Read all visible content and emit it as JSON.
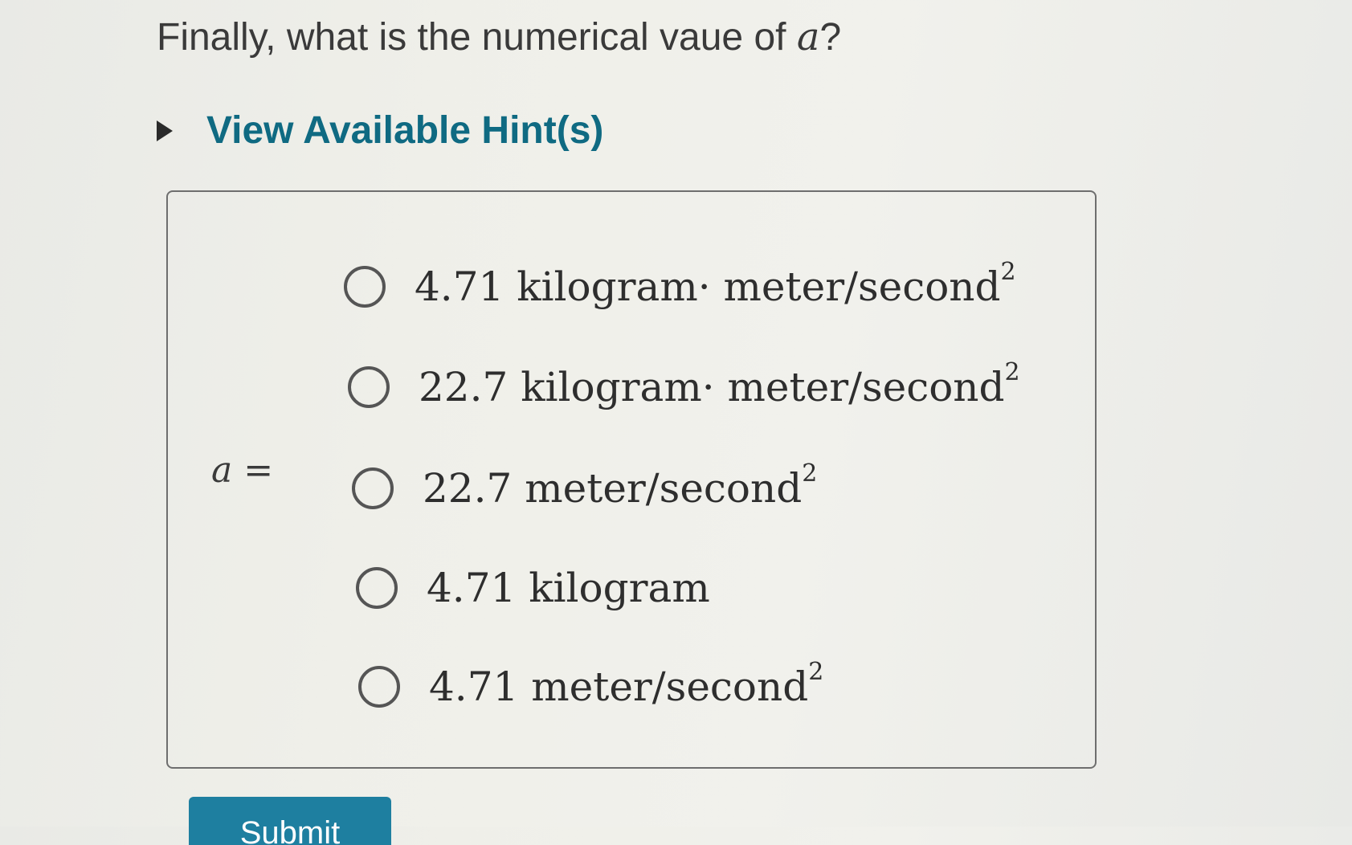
{
  "question": {
    "text_prefix": "Finally, what is the numerical vaue of ",
    "variable": "a",
    "text_suffix": "?"
  },
  "hint": {
    "label": "View Available Hint(s)",
    "icon": "triangle-right-icon"
  },
  "answer": {
    "label_variable": "a",
    "label_equals": " =",
    "options": [
      {
        "main": "4.71 kilogram· meter/second",
        "exponent": "2"
      },
      {
        "main": "22.7 kilogram· meter/second",
        "exponent": "2"
      },
      {
        "main": "22.7 meter/second",
        "exponent": "2"
      },
      {
        "main": "4.71 kilogram",
        "exponent": ""
      },
      {
        "main": "4.71 meter/second",
        "exponent": "2"
      }
    ]
  },
  "submit": {
    "label": "Submit"
  },
  "colors": {
    "link": "#0f6a82",
    "button": "#1e7fa0"
  }
}
